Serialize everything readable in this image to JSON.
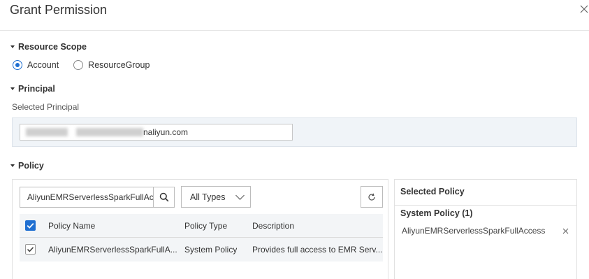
{
  "dialog": {
    "title": "Grant Permission"
  },
  "resource_scope": {
    "heading": "Resource Scope",
    "options": [
      "Account",
      "ResourceGroup"
    ],
    "selected": "Account"
  },
  "principal": {
    "heading": "Principal",
    "label": "Selected Principal",
    "value_visible_suffix": "naliyun.com"
  },
  "policy": {
    "heading": "Policy",
    "search_value": "AliyunEMRServerlessSparkFullAc",
    "type_filter": "All Types",
    "table": {
      "columns": [
        "Policy Name",
        "Policy Type",
        "Description"
      ],
      "rows": [
        {
          "checked": true,
          "name": "AliyunEMRServerlessSparkFullA...",
          "type": "System Policy",
          "description": "Provides full access to EMR Serv..."
        }
      ]
    }
  },
  "selected_policy": {
    "title": "Selected Policy",
    "group_label": "System Policy (1)",
    "items": [
      "AliyunEMRServerlessSparkFullAccess"
    ]
  },
  "colors": {
    "accent": "#1f6fd1",
    "panel_bg": "#f0f4f8",
    "table_bg": "#f3f5f7"
  },
  "icons": [
    "close-icon",
    "caret-down-icon",
    "search-icon",
    "chevron-down-icon",
    "refresh-icon",
    "checkbox-icon",
    "remove-icon"
  ]
}
